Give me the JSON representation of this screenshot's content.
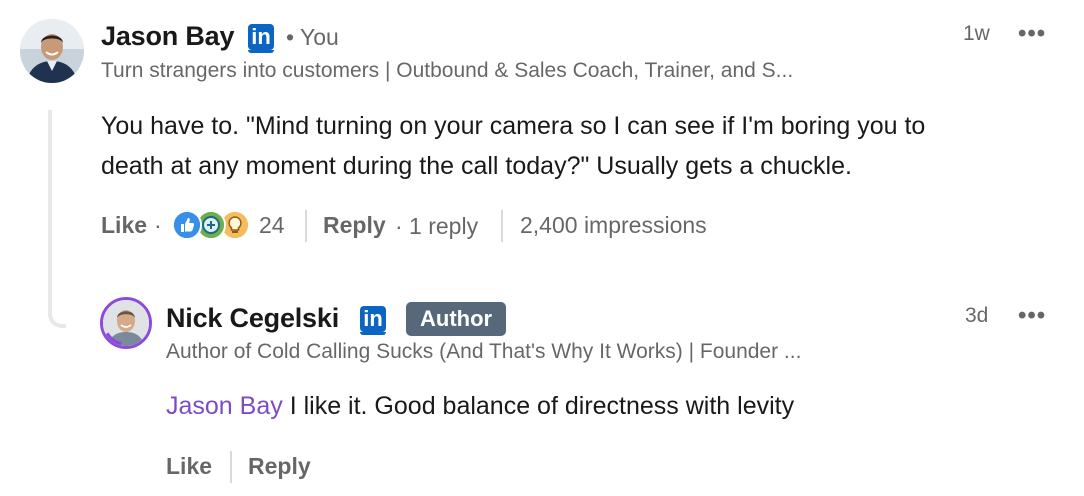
{
  "comment": {
    "author_name": "Jason Bay",
    "you_label": "• You",
    "headline": "Turn strangers into customers | Outbound & Sales Coach, Trainer, and S...",
    "time": "1w",
    "more_label": "•••",
    "body_line1": "You have to. \"Mind turning on your camera so I can see if I'm boring you to",
    "body_line2": "death at any moment during the call today?\" Usually gets a chuckle.",
    "like_label": "Like",
    "dot": "·",
    "reaction_icons": [
      "like-reaction-icon",
      "celebrate-reaction-icon",
      "insightful-reaction-icon"
    ],
    "reaction_count": "24",
    "reply_label": "Reply",
    "reply_count": "· 1 reply",
    "impressions": "2,400 impressions"
  },
  "reply": {
    "author_name": "Nick Cegelski",
    "author_badge": "Author",
    "headline": "Author of Cold Calling Sucks (And That's Why It Works) | Founder ...",
    "time": "3d",
    "more_label": "•••",
    "mention": "Jason Bay",
    "body": " I like it. Good balance of directness with levity",
    "like_label": "Like",
    "reply_label": "Reply"
  },
  "linkedin_badge": "in",
  "colors": {
    "linkedin_blue": "#0a66c2",
    "mention_purple": "#7e4bc2",
    "author_badge_bg": "#56687a",
    "open_to_work_ring": "#8b4dd9"
  }
}
